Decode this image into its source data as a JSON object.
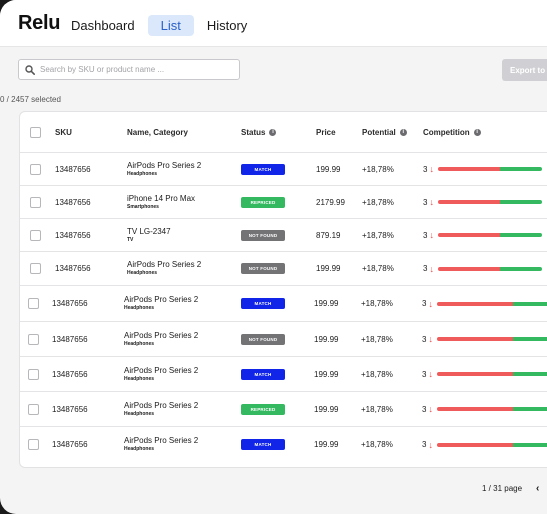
{
  "app": {
    "logo": "Relu"
  },
  "nav": {
    "items": [
      {
        "label": "Dashboard",
        "active": false
      },
      {
        "label": "List",
        "active": true
      },
      {
        "label": "History",
        "active": false
      }
    ]
  },
  "search": {
    "placeholder": "Search by SKU or product name ...",
    "value": ""
  },
  "export_label": "Export to",
  "selected_text": "0 / 2457 selected",
  "columns": {
    "sku": "SKU",
    "name": "Name, Category",
    "status": "Status",
    "price": "Price",
    "potential": "Potential",
    "competition": "Competition"
  },
  "status_colors": {
    "MATCH": "#1025e8",
    "REPRICED": "#34b961",
    "NOT FOUND": "#737376"
  },
  "rows": [
    {
      "sku": "13487656",
      "name": "AirPods Pro Series 2",
      "category": "Headphones",
      "status": "MATCH",
      "price": "199.99",
      "potential": "+18,78%",
      "competition": "3"
    },
    {
      "sku": "13487656",
      "name": "iPhone 14 Pro Max",
      "category": "Smartphones",
      "status": "REPRICED",
      "price": "2179.99",
      "potential": "+18,78%",
      "competition": "3"
    },
    {
      "sku": "13487656",
      "name": "TV LG-2347",
      "category": "TV",
      "status": "NOT FOUND",
      "price": "879.19",
      "potential": "+18,78%",
      "competition": "3"
    },
    {
      "sku": "13487656",
      "name": "AirPods Pro Series 2",
      "category": "Headphones",
      "status": "NOT FOUND",
      "price": "199.99",
      "potential": "+18,78%",
      "competition": "3"
    },
    {
      "sku": "13487656",
      "name": "AirPods Pro Series 2",
      "category": "Headphones",
      "status": "MATCH",
      "price": "199.99",
      "potential": "+18,78%",
      "competition": "3"
    },
    {
      "sku": "13487656",
      "name": "AirPods Pro Series 2",
      "category": "Headphones",
      "status": "NOT FOUND",
      "price": "199.99",
      "potential": "+18,78%",
      "competition": "3"
    },
    {
      "sku": "13487656",
      "name": "AirPods Pro Series 2",
      "category": "Headphones",
      "status": "MATCH",
      "price": "199.99",
      "potential": "+18,78%",
      "competition": "3"
    },
    {
      "sku": "13487656",
      "name": "AirPods Pro Series 2",
      "category": "Headphones",
      "status": "REPRICED",
      "price": "199.99",
      "potential": "+18,78%",
      "competition": "3"
    },
    {
      "sku": "13487656",
      "name": "AirPods Pro Series 2",
      "category": "Headphones",
      "status": "MATCH",
      "price": "199.99",
      "potential": "+18,78%",
      "competition": "3"
    }
  ],
  "pagination": {
    "text": "1 / 31 page"
  }
}
